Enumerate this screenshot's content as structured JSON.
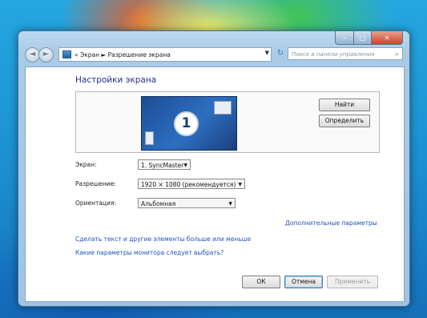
{
  "window": {
    "navigation": {
      "back": "◄",
      "forward": "►",
      "address_prefix": "«",
      "breadcrumb": [
        "Экран",
        "Разрешение экрана"
      ],
      "breadcrumb_sep": "►",
      "refresh": "↻",
      "search_placeholder": "Поиск в панели управления"
    },
    "caption": {
      "min": "‒",
      "max": "□",
      "close": "✕"
    }
  },
  "content": {
    "title": "Настройки экрана",
    "monitor_number": "1",
    "find_button": "Найти",
    "detect_button": "Определить",
    "fields": {
      "screen_label": "Экран:",
      "screen_value": "1. SyncMaster",
      "resolution_label": "Разрешение:",
      "resolution_value": "1920 × 1080 (рекомендуется)",
      "orientation_label": "Ориентация:",
      "orientation_value": "Альбомная"
    },
    "advanced_link": "Дополнительные параметры",
    "links": [
      "Сделать текст и другие элементы больше или меньше",
      "Какие параметры монитора следует выбрать?"
    ],
    "buttons": {
      "ok": "ОК",
      "cancel": "Отмена",
      "apply": "Применить"
    }
  },
  "icons": [
    "back-arrow-icon",
    "forward-arrow-icon",
    "control-panel-icon",
    "dropdown-arrow-icon",
    "refresh-icon",
    "search-icon",
    "monitor-icon"
  ]
}
